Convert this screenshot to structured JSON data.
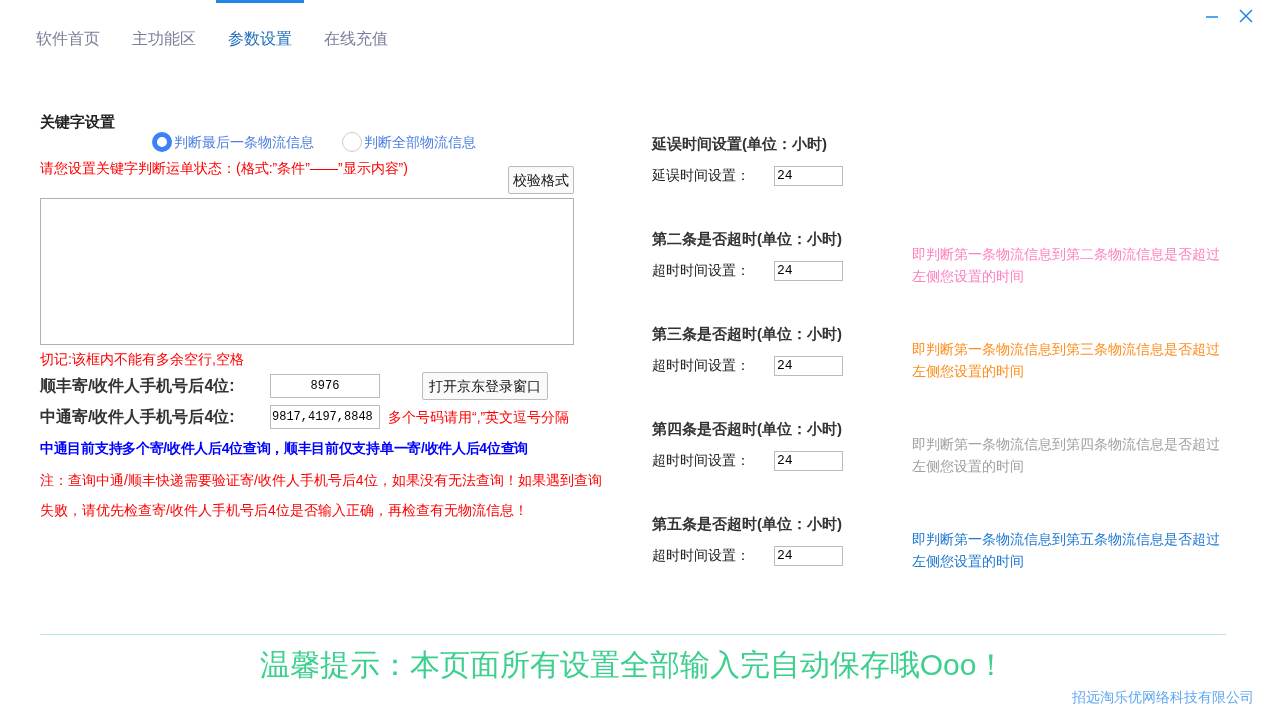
{
  "tabs": [
    {
      "label": "软件首页",
      "selected": false
    },
    {
      "label": "主功能区",
      "selected": false
    },
    {
      "label": "参数设置",
      "selected": true
    },
    {
      "label": "在线充值",
      "selected": false
    }
  ],
  "keyword": {
    "title": "关键字设置",
    "radios": [
      {
        "label": "判断最后一条物流信息",
        "selected": true
      },
      {
        "label": "判断全部物流信息",
        "selected": false
      }
    ],
    "prompt": "请您设置关键字判断运单状态：(格式:”条件”——”显示内容”)",
    "check_button": "校验格式",
    "warning": "切记:该框内不能有多余空行,空格"
  },
  "phone_rows": [
    {
      "label": "顺丰寄/收件人手机号后4位:",
      "value": "8976",
      "kind": "button",
      "extra": "打开京东登录窗口"
    },
    {
      "label": "中通寄/收件人手机号后4位:",
      "value": "9817,4197,8848",
      "kind": "hint",
      "extra": "多个号码请用“,”英文逗号分隔"
    }
  ],
  "support_note": "中通目前支持多个寄/收件人后4位查询，顺丰目前仅支持单一寄/收件人后4位查询",
  "notice": "注：查询中通/顺丰快递需要验证寄/收件人手机号后4位，如果没有无法查询！如果遇到查询失败，请优先检查寄/收件人手机号后4位是否输入正确，再检查有无物流信息！",
  "time_sections": [
    {
      "title": "延误时间设置(单位：小时)",
      "label": "延误时间设置：",
      "value": "24"
    },
    {
      "title": "第二条是否超时(单位：小时)",
      "label": "超时时间设置：",
      "value": "24",
      "description": "即判断第一条物流信息到第二条物流信息是否超过左侧您设置的时间",
      "color": "#ff7fbf"
    },
    {
      "title": "第三条是否超时(单位：小时)",
      "label": "超时时间设置：",
      "value": "24",
      "description": "即判断第一条物流信息到第三条物流信息是否超过左侧您设置的时间",
      "color": "#ff8c1a"
    },
    {
      "title": "第四条是否超时(单位：小时)",
      "label": "超时时间设置：",
      "value": "24",
      "description": "即判断第一条物流信息到第四条物流信息是否超过左侧您设置的时间",
      "color": "#a0a0a0"
    },
    {
      "title": "第五条是否超时(单位：小时)",
      "label": "超时时间设置：",
      "value": "24",
      "description": "即判断第一条物流信息到第五条物流信息是否超过左侧您设置的时间",
      "color": "#1e78d2"
    }
  ],
  "footer": {
    "tip": "温馨提示：本页面所有设置全部输入完自动保存哦Ooo！",
    "company": "招远淘乐优网络科技有限公司"
  }
}
